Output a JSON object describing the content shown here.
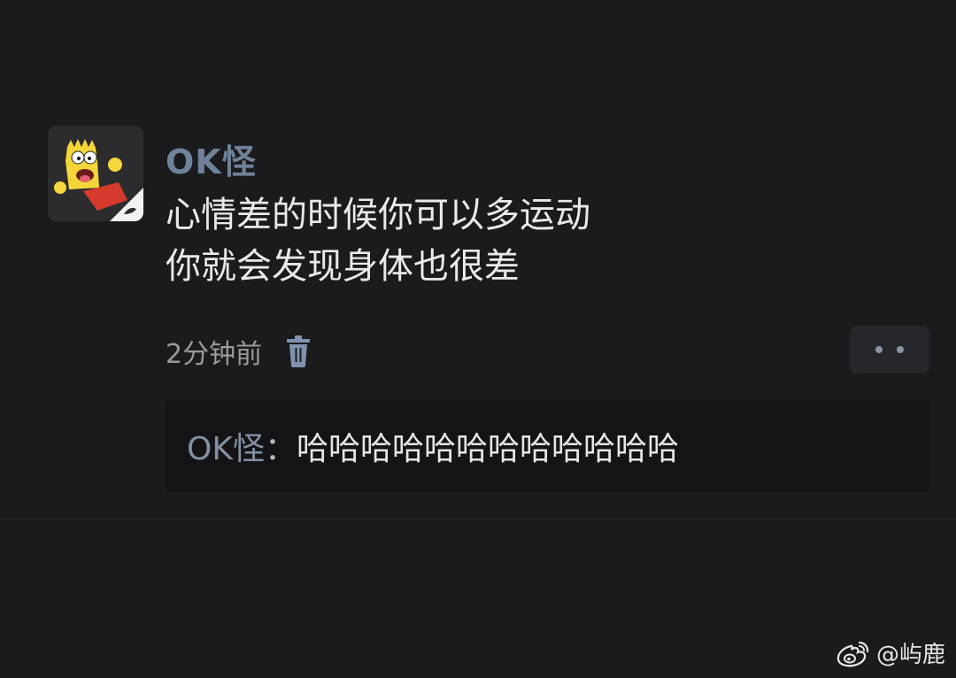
{
  "comment": {
    "username": "OK怪",
    "lines": [
      "心情差的时候你可以多运动",
      "你就会发现身体也很差"
    ],
    "timestamp": "2分钟前"
  },
  "reply": {
    "author": "OK怪",
    "separator": "：",
    "text": "哈哈哈哈哈哈哈哈哈哈哈哈"
  },
  "watermark": {
    "text": "@屿鹿"
  },
  "icons": {
    "avatar": "cartoon-avatar-icon",
    "delete": "trash-icon",
    "more": "more-dots-icon",
    "watermark": "weibo-logo-icon"
  },
  "colors": {
    "background": "#1b1b1d",
    "username": "#6f8299",
    "text": "#e9e9ea",
    "reply_box": "#141416"
  }
}
